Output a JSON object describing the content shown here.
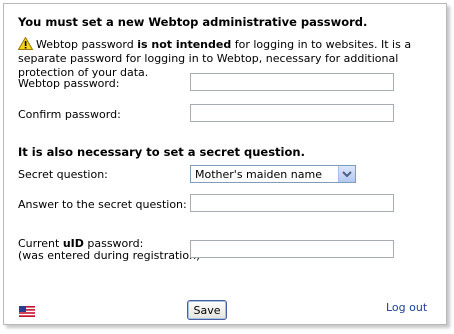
{
  "heading_password": "You must set a new Webtop administrative password.",
  "notice": {
    "part1": "Webtop password ",
    "emphasis": "is not intended",
    "part2": " for logging in to websites. It is a separate password for logging in to Webtop, necessary for additional protection of your data."
  },
  "fields": {
    "webtop_password_label": "Webtop password:",
    "confirm_password_label": "Confirm password:",
    "secret_question_label": "Secret question:",
    "secret_question_value": "Mother's maiden name",
    "answer_label": "Answer to the secret question:",
    "uid_label_part1": "Current ",
    "uid_label_bold": "uID",
    "uid_label_part2": " password:",
    "uid_label_note": "(was entered during registration)"
  },
  "heading_secret": "It is also necessary to set a secret question.",
  "buttons": {
    "save": "Save",
    "logout": "Log out"
  },
  "icons": {
    "warning": "warning-icon",
    "flag": "us-flag-icon"
  },
  "colors": {
    "link": "#1f3c99",
    "warning_fill": "#f6d31e"
  }
}
